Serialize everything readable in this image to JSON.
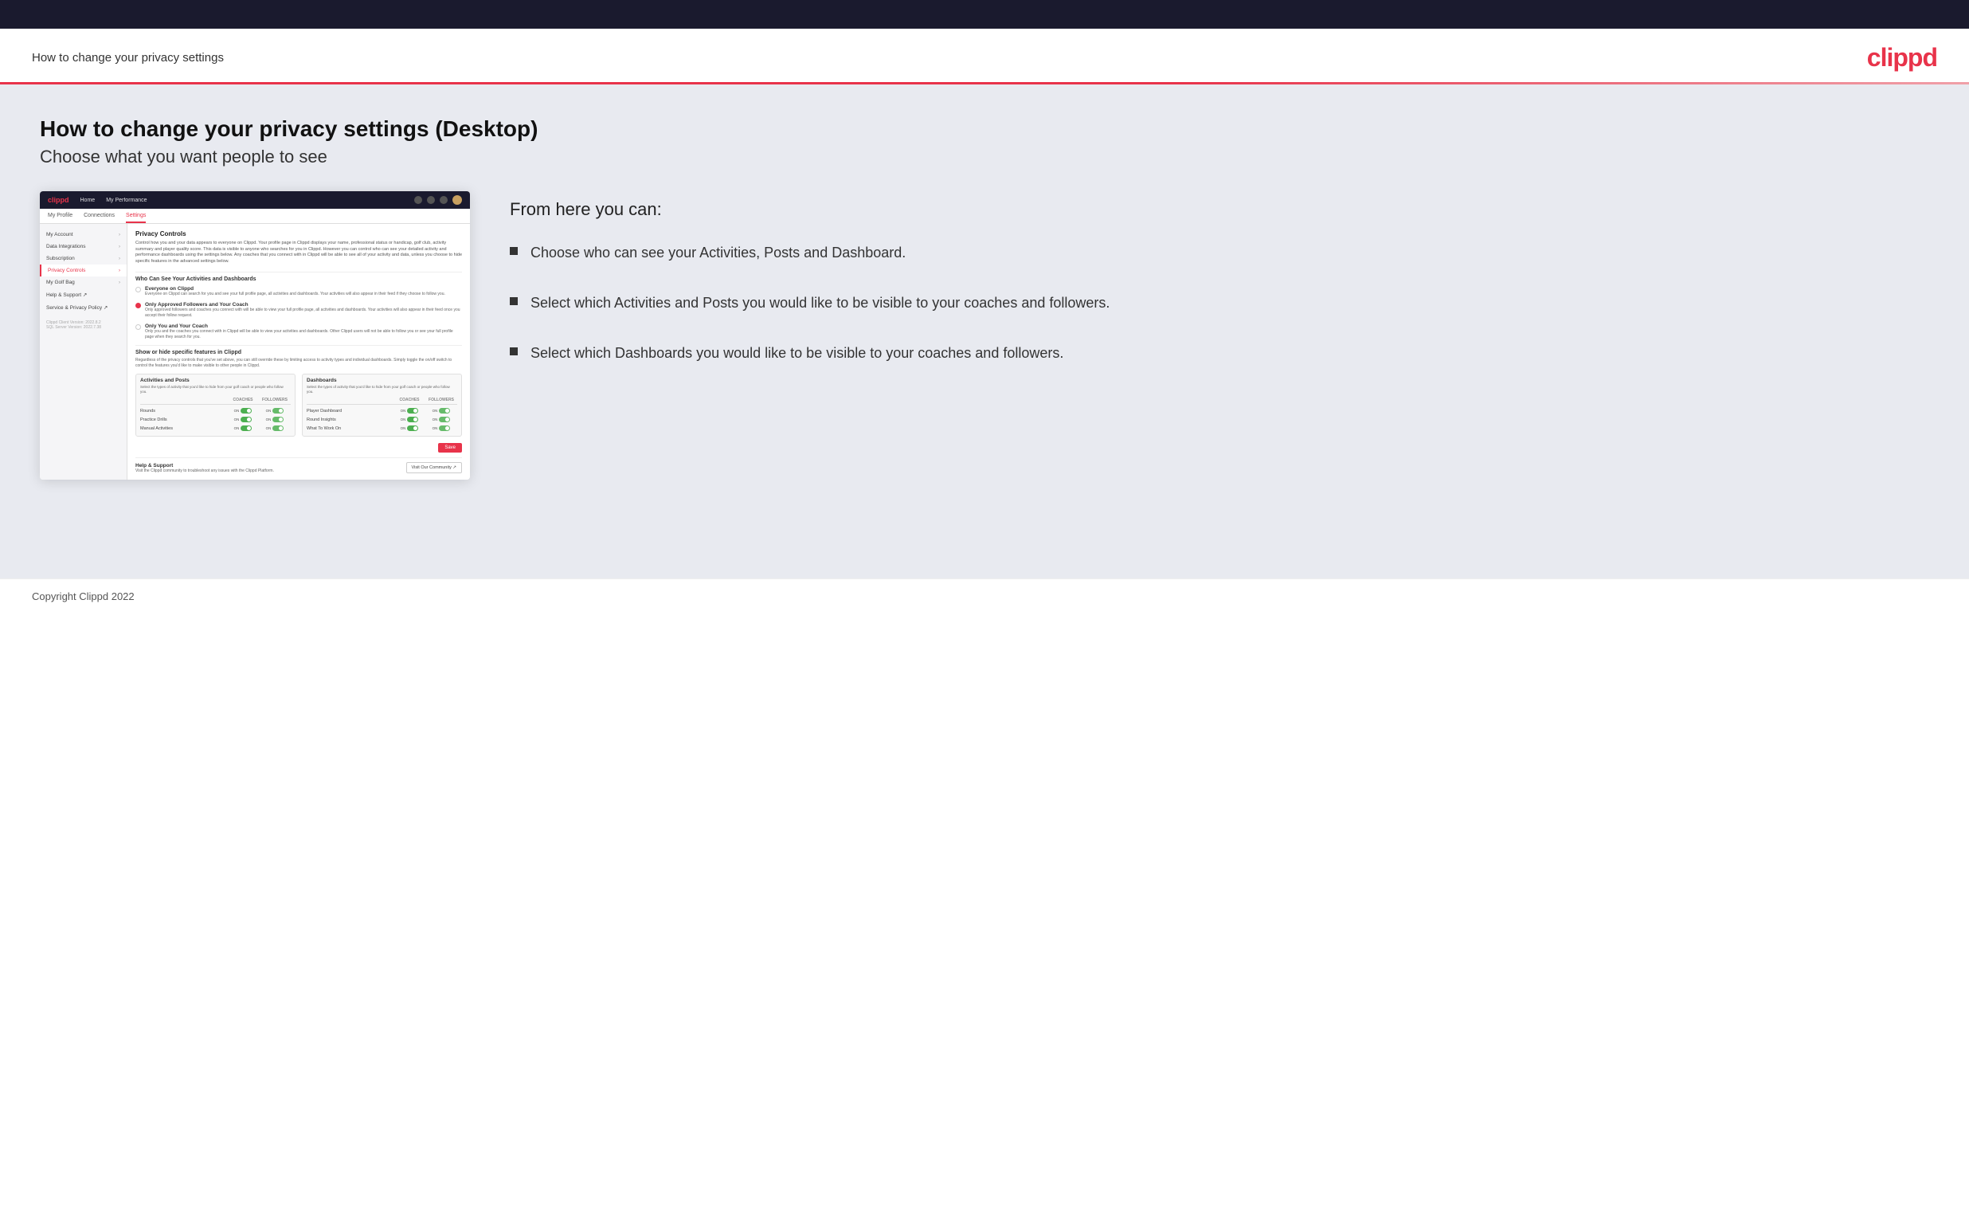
{
  "header": {
    "title": "How to change your privacy settings",
    "logo": "clippd"
  },
  "main": {
    "heading": "How to change your privacy settings (Desktop)",
    "subheading": "Choose what you want people to see",
    "from_here_title": "From here you can:",
    "bullets": [
      {
        "text": "Choose who can see your Activities, Posts and Dashboard."
      },
      {
        "text": "Select which Activities and Posts you would like to be visible to your coaches and followers."
      },
      {
        "text": "Select which Dashboards you would like to be visible to your coaches and followers."
      }
    ]
  },
  "mock": {
    "logo": "clippd",
    "nav_links": [
      "Home",
      "My Performance"
    ],
    "tabs": [
      "My Profile",
      "Connections",
      "Settings"
    ],
    "active_tab": "Settings",
    "sidebar_items": [
      {
        "label": "My Account",
        "active": false
      },
      {
        "label": "Data Integrations",
        "active": false
      },
      {
        "label": "Subscription",
        "active": false
      },
      {
        "label": "Privacy Controls",
        "active": true
      },
      {
        "label": "My Golf Bag",
        "active": false
      },
      {
        "label": "Help & Support ↗",
        "active": false
      },
      {
        "label": "Service & Privacy Policy ↗",
        "active": false
      }
    ],
    "sidebar_version": "Clippd Client Version: 2022.8.2\nSQL Server Version: 2022.7.38",
    "section_title": "Privacy Controls",
    "section_desc": "Control how you and your data appears to everyone on Clippd. Your profile page in Clippd displays your name, professional status or handicap, golf club, activity summary and player quality score. This data is visible to anyone who searches for you in Clippd. However you can control who can see your detailed activity and performance dashboards using the settings below. Any coaches that you connect with in Clippd will be able to see all of your activity and data, unless you choose to hide specific features in the advanced settings below.",
    "who_title": "Who Can See Your Activities and Dashboards",
    "radio_options": [
      {
        "label": "Everyone on Clippd",
        "desc": "Everyone on Clippd can search for you and see your full profile page, all activities and dashboards. Your activities will also appear in their feed if they choose to follow you.",
        "selected": false
      },
      {
        "label": "Only Approved Followers and Your Coach",
        "desc": "Only approved followers and coaches you connect with will be able to view your full profile page, all activities and dashboards. Your activities will also appear in their feed once you accept their follow request.",
        "selected": true
      },
      {
        "label": "Only You and Your Coach",
        "desc": "Only you and the coaches you connect with in Clippd will be able to view your activities and dashboards. Other Clippd users will not be able to follow you or see your full profile page when they search for you.",
        "selected": false
      }
    ],
    "show_hide_title": "Show or hide specific features in Clippd",
    "show_hide_desc": "Regardless of the privacy controls that you've set above, you can still override these by limiting access to activity types and individual dashboards. Simply toggle the on/off switch to control the features you'd like to make visible to other people in Clippd.",
    "activities_table": {
      "title": "Activities and Posts",
      "desc": "Select the types of activity that you'd like to hide from your golf coach or people who follow you.",
      "columns": [
        "COACHES",
        "FOLLOWERS"
      ],
      "rows": [
        {
          "label": "Rounds"
        },
        {
          "label": "Practice Drills"
        },
        {
          "label": "Manual Activities"
        }
      ]
    },
    "dashboards_table": {
      "title": "Dashboards",
      "desc": "Select the types of activity that you'd like to hide from your golf coach or people who follow you.",
      "columns": [
        "COACHES",
        "FOLLOWERS"
      ],
      "rows": [
        {
          "label": "Player Dashboard"
        },
        {
          "label": "Round Insights"
        },
        {
          "label": "What To Work On"
        }
      ]
    },
    "save_label": "Save",
    "help_title": "Help & Support",
    "help_desc": "Visit the Clippd community to troubleshoot any issues with the Clippd Platform.",
    "visit_community_label": "Visit Our Community ↗"
  },
  "footer": {
    "copyright": "Copyright Clippd 2022"
  }
}
